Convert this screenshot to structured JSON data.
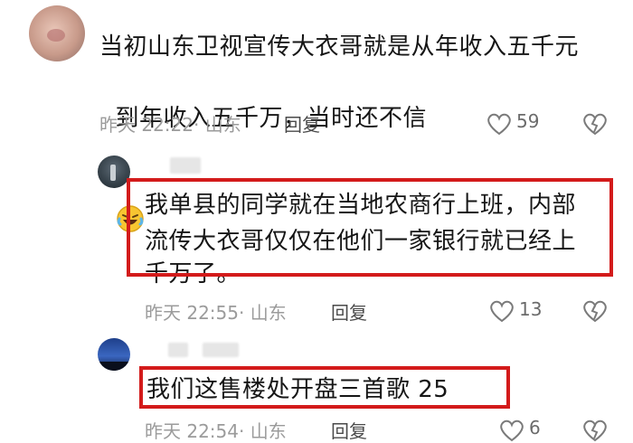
{
  "comments": [
    {
      "text_line1": "当初山东卫视宣传大衣哥就是从年收入五千元",
      "text_line2": "到年收入五千万，当时还不信",
      "emoji": "laughing-crying-emoji",
      "time": "昨天 22:22",
      "location": "· 山东",
      "reply": "回复",
      "likes": "59"
    },
    {
      "text_line1": "我单县的同学就在当地农商行上班，内部",
      "text_line2": "流传大衣哥仅仅在他们一家银行就已经上",
      "text_line3": "千万了。",
      "time": "昨天 22:55",
      "location": "· 山东",
      "reply": "回复",
      "likes": "13"
    },
    {
      "text_line1": "我们这售楼处开盘三首歌 25",
      "time": "昨天 22:54",
      "location": "· 山东",
      "reply": "回复",
      "likes": "6"
    }
  ],
  "colors": {
    "highlight": "#d31b1b",
    "meta": "#9b9b9b"
  }
}
